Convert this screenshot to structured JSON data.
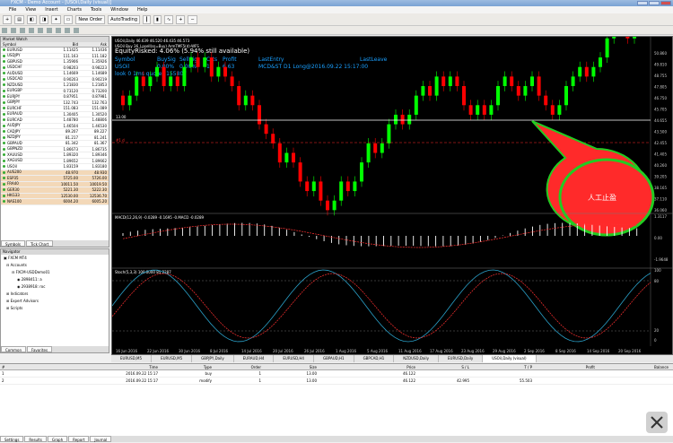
{
  "window": {
    "title": "FXCM - Demo Account - [USOil,Daily (visual)]"
  },
  "menu": [
    "File",
    "View",
    "Insert",
    "Charts",
    "Tools",
    "Window",
    "Help"
  ],
  "toolbar": {
    "new_order": "New Order",
    "autotrading": "AutoTrading"
  },
  "market_watch": {
    "title": "Market Watch",
    "cols": [
      "Symbol",
      "Bid",
      "Ask"
    ],
    "rows": [
      [
        "EURUSD",
        "1.11425",
        "1.11436"
      ],
      [
        "USDJPY",
        "111.163",
        "111.182"
      ],
      [
        "GBPUSD",
        "1.35906",
        "1.35926"
      ],
      [
        "USDCHF",
        "0.98203",
        "0.98223"
      ],
      [
        "AUDUSD",
        "1.14669",
        "1.14689"
      ],
      [
        "USDCAD",
        "0.90203",
        "0.90219"
      ],
      [
        "NZDUSD",
        "1.21830",
        "1.21853"
      ],
      [
        "EURGBP",
        "0.73120",
        "0.73200"
      ],
      [
        "EURJPY",
        "0.87951",
        "0.87981"
      ],
      [
        "GBPJPY",
        "132.743",
        "132.763"
      ],
      [
        "EURCHF",
        "151.083",
        "151.089"
      ],
      [
        "EURAUD",
        "1.30405",
        "1.30520"
      ],
      [
        "EURCAD",
        "1.48780",
        "1.48806"
      ],
      [
        "AUDJPY",
        "1.46504",
        "1.46530"
      ],
      [
        "CADJPY",
        "89.207",
        "89.227"
      ],
      [
        "NZDJPY",
        "81.217",
        "81.241"
      ],
      [
        "GBPAUD",
        "81.342",
        "81.367"
      ],
      [
        "GBPNZD",
        "1.86673",
        "1.86735"
      ],
      [
        "XAUUSD",
        "1.89320",
        "1.89346"
      ],
      [
        "XAGUSD",
        "1.89652",
        "1.89662"
      ],
      [
        "USOil",
        "1.83159",
        "1.83180"
      ],
      [
        "AUS200",
        "48.970",
        "48.930"
      ],
      [
        "ESP35",
        "5725.00",
        "5726.00"
      ],
      [
        "FRA40",
        "10011.50",
        "10019.50"
      ],
      [
        "GER30",
        "5221.30",
        "5222.30"
      ],
      [
        "HKG33",
        "12530.00",
        "12536.70"
      ],
      [
        "NAS100",
        "6004.20",
        "6005.20"
      ]
    ],
    "tabs": [
      "Symbols",
      "Tick Chart"
    ]
  },
  "navigator": {
    "title": "Navigator",
    "tree": [
      "FXCM MT4",
      "Accounts",
      "FXCM-USDDemo01",
      "2898411: a",
      "2938918: roc",
      "Indicators",
      "Expert Advisors",
      "Scripts"
    ],
    "tabs": [
      "Common",
      "Favorites"
    ]
  },
  "chart": {
    "header_lines": [
      "USOil,Daily  46.639 46.520 46.435 46.573",
      "USOil Buy 36_Lpsell(ss=Buy) ArmTMF5(d)-WFS",
      "EquityRisked: 4.06% (5.94% still available)"
    ],
    "table_head": [
      "Symbol",
      "BuySig",
      "SellSig",
      "Crts",
      "Profit",
      "LastEntry",
      "LastLeave"
    ],
    "table_row": [
      "USOil",
      "0.00%",
      "0.00%",
      "1",
      "6.63",
      "MCD&ST D1 Long@2016.09.22 15:17:00",
      ""
    ],
    "tick_line": "look 0 1ms quotes 155807",
    "line_left_label": "13.00",
    "line_right_label": "#1 d",
    "bubble_text": "人工止盈",
    "macd_label": "MACD(12,26,9) -0.0289 -0.1695 -0.MACD -0.0289",
    "stoch_label": "Stoch(5,3,3) 100.0000 85.2287",
    "price_axis": [
      "50.860",
      "49.810",
      "48.755",
      "47.805",
      "46.750",
      "45.705",
      "44.655",
      "43.500",
      "42.455",
      "41.405",
      "40.260",
      "39.205",
      "38.165",
      "37.110",
      "36.060"
    ],
    "macd_axis": [
      "1.3117",
      "0.00",
      "-1.9648"
    ],
    "stoch_axis": [
      "100",
      "80",
      "20",
      "0"
    ],
    "time_axis": [
      "16 Jun 2016",
      "22 Jun 2016",
      "30 Jun 2016",
      "8 Jul 2016",
      "14 Jul 2016",
      "20 Jul 2016",
      "26 Jul 2016",
      "1 Aug 2016",
      "5 Aug 2016",
      "11 Aug 2016",
      "17 Aug 2016",
      "23 Aug 2016",
      "29 Aug 2016",
      "2 Sep 2016",
      "8 Sep 2016",
      "14 Sep 2016",
      "20 Sep 2016"
    ],
    "colors": {
      "bull": "#00ff00",
      "bear": "#ff0000",
      "bubble": "#ff2a2a",
      "bubble_border": "#22cc22",
      "header_text": "#1aa0ff"
    }
  },
  "chart_tabs": [
    "EURUSD,M5",
    "EURUSD,M5",
    "GBPJPY,Daily",
    "EURAUD,H4",
    "EURUSD,H4",
    "GBPAUD,H1",
    "GBPCAD,H1",
    "NZDUSD,Daily",
    "EURUSD,Daily",
    "USOil,Daily (visual)"
  ],
  "terminal": {
    "cols": [
      "#",
      "Time",
      "Type",
      "Order",
      "Size",
      "Price",
      "S / L",
      "T / P",
      "Profit",
      "Balance"
    ],
    "rows": [
      [
        "1",
        "2016.09.22 15:17",
        "buy",
        "1",
        "13.00",
        "46.122",
        "",
        "",
        " ",
        ""
      ],
      [
        "2",
        "2016.09.22 15:17",
        "modify",
        "1",
        "13.00",
        "46.122",
        "42.995",
        "55.503",
        "",
        ""
      ]
    ],
    "tabs": [
      "Settings",
      "Results",
      "Graph",
      "Report",
      "Journal"
    ]
  }
}
